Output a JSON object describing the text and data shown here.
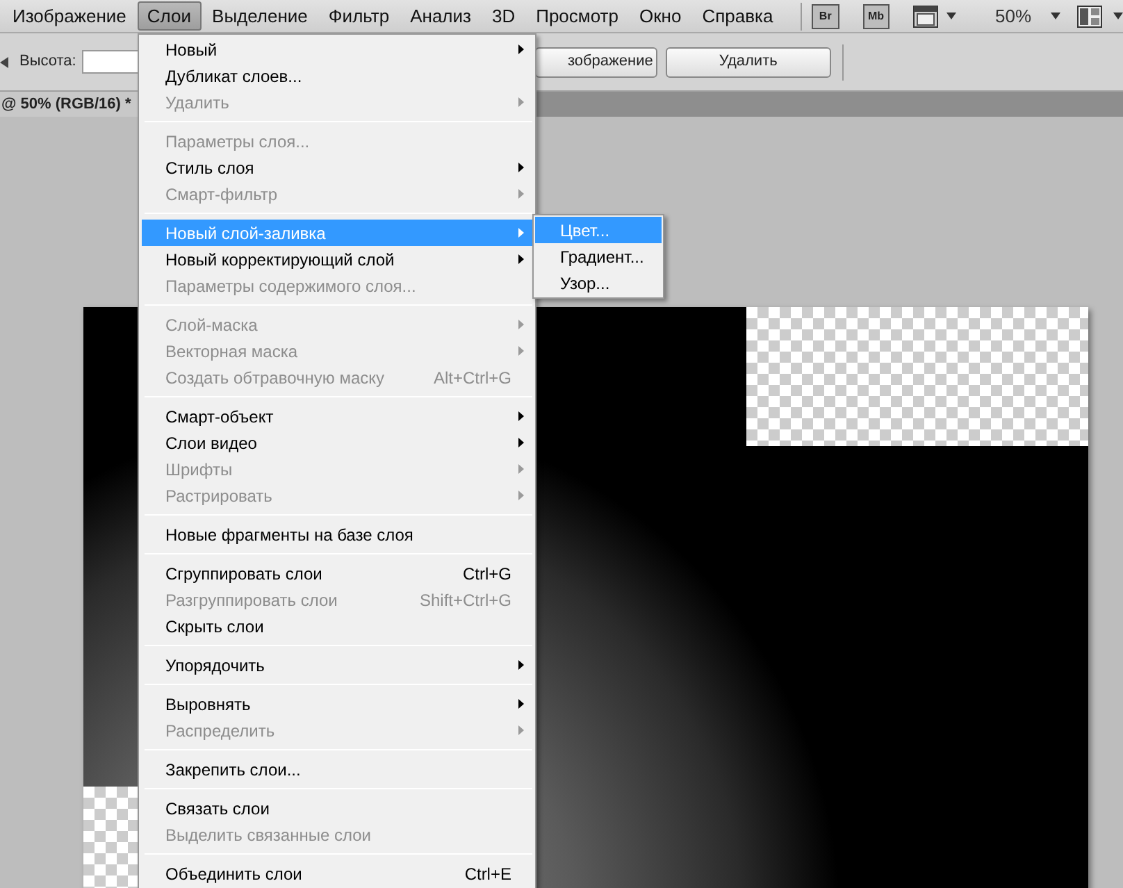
{
  "menu_bar": {
    "items": [
      {
        "label": "Изображение",
        "selected": false
      },
      {
        "label": "Слои",
        "selected": true
      },
      {
        "label": "Выделение",
        "selected": false
      },
      {
        "label": "Фильтр",
        "selected": false
      },
      {
        "label": "Анализ",
        "selected": false
      },
      {
        "label": "3D",
        "selected": false
      },
      {
        "label": "Просмотр",
        "selected": false
      },
      {
        "label": "Окно",
        "selected": false
      },
      {
        "label": "Справка",
        "selected": false
      }
    ],
    "app_buttons": [
      "Br",
      "Mb"
    ],
    "zoom": "50%"
  },
  "options_bar": {
    "height_label": "Высота:",
    "buttons": [
      "зображение",
      "Удалить"
    ]
  },
  "document_tab": {
    "title": "@ 50% (RGB/16) *"
  },
  "layer_menu": [
    {
      "kind": "item",
      "label": "Новый",
      "disabled": false,
      "submenu": true,
      "selected": false
    },
    {
      "kind": "item",
      "label": "Дубликат слоев...",
      "disabled": false,
      "submenu": false,
      "selected": false
    },
    {
      "kind": "item",
      "label": "Удалить",
      "disabled": true,
      "submenu": true,
      "selected": false
    },
    {
      "kind": "separator"
    },
    {
      "kind": "item",
      "label": "Параметры слоя...",
      "disabled": true,
      "submenu": false,
      "selected": false
    },
    {
      "kind": "item",
      "label": "Стиль слоя",
      "disabled": false,
      "submenu": true,
      "selected": false
    },
    {
      "kind": "item",
      "label": "Смарт-фильтр",
      "disabled": true,
      "submenu": true,
      "selected": false
    },
    {
      "kind": "separator"
    },
    {
      "kind": "item",
      "label": "Новый слой-заливка",
      "disabled": false,
      "submenu": true,
      "selected": true
    },
    {
      "kind": "item",
      "label": "Новый корректирующий слой",
      "disabled": false,
      "submenu": true,
      "selected": false
    },
    {
      "kind": "item",
      "label": "Параметры содержимого слоя...",
      "disabled": true,
      "submenu": false,
      "selected": false
    },
    {
      "kind": "separator"
    },
    {
      "kind": "item",
      "label": "Слой-маска",
      "disabled": true,
      "submenu": true,
      "selected": false
    },
    {
      "kind": "item",
      "label": "Векторная маска",
      "disabled": true,
      "submenu": true,
      "selected": false
    },
    {
      "kind": "item",
      "label": "Создать обтравочную маску",
      "disabled": true,
      "submenu": false,
      "selected": false,
      "shortcut": "Alt+Ctrl+G"
    },
    {
      "kind": "separator"
    },
    {
      "kind": "item",
      "label": "Смарт-объект",
      "disabled": false,
      "submenu": true,
      "selected": false
    },
    {
      "kind": "item",
      "label": "Слои видео",
      "disabled": false,
      "submenu": true,
      "selected": false
    },
    {
      "kind": "item",
      "label": "Шрифты",
      "disabled": true,
      "submenu": true,
      "selected": false
    },
    {
      "kind": "item",
      "label": "Растрировать",
      "disabled": true,
      "submenu": true,
      "selected": false
    },
    {
      "kind": "separator"
    },
    {
      "kind": "item",
      "label": "Новые фрагменты на базе слоя",
      "disabled": false,
      "submenu": false,
      "selected": false
    },
    {
      "kind": "separator"
    },
    {
      "kind": "item",
      "label": "Сгруппировать слои",
      "disabled": false,
      "submenu": false,
      "selected": false,
      "shortcut": "Ctrl+G"
    },
    {
      "kind": "item",
      "label": "Разгруппировать слои",
      "disabled": true,
      "submenu": false,
      "selected": false,
      "shortcut": "Shift+Ctrl+G"
    },
    {
      "kind": "item",
      "label": "Скрыть слои",
      "disabled": false,
      "submenu": false,
      "selected": false
    },
    {
      "kind": "separator"
    },
    {
      "kind": "item",
      "label": "Упорядочить",
      "disabled": false,
      "submenu": true,
      "selected": false
    },
    {
      "kind": "separator"
    },
    {
      "kind": "item",
      "label": "Выровнять",
      "disabled": false,
      "submenu": true,
      "selected": false
    },
    {
      "kind": "item",
      "label": "Распределить",
      "disabled": true,
      "submenu": true,
      "selected": false
    },
    {
      "kind": "separator"
    },
    {
      "kind": "item",
      "label": "Закрепить слои...",
      "disabled": false,
      "submenu": false,
      "selected": false
    },
    {
      "kind": "separator"
    },
    {
      "kind": "item",
      "label": "Связать слои",
      "disabled": false,
      "submenu": false,
      "selected": false
    },
    {
      "kind": "item",
      "label": "Выделить связанные слои",
      "disabled": true,
      "submenu": false,
      "selected": false
    },
    {
      "kind": "separator"
    },
    {
      "kind": "item",
      "label": "Объединить слои",
      "disabled": false,
      "submenu": false,
      "selected": false,
      "shortcut": "Ctrl+E"
    }
  ],
  "fill_layer_submenu": [
    {
      "label": "Цвет...",
      "selected": true
    },
    {
      "label": "Градиент...",
      "selected": false
    },
    {
      "label": "Узор...",
      "selected": false
    }
  ]
}
